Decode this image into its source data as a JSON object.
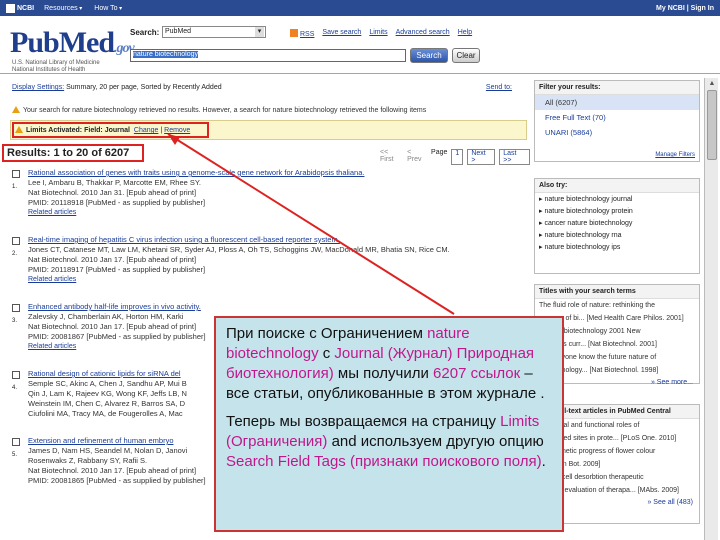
{
  "ncbi": {
    "logo": "NCBI",
    "resources": "Resources",
    "howto": "How To",
    "account": "My NCBI | Sign In"
  },
  "header": {
    "logo_main": "PubMed",
    "logo_gov": ".gov",
    "sub1": "U.S. National Library of Medicine",
    "sub2": "National Institutes of Health",
    "search_label": "Search:",
    "db_value": "PubMed",
    "links": [
      "RSS",
      "Save search",
      "Limits",
      "Advanced search",
      "Help"
    ],
    "query": "nature biotechnology",
    "search_btn": "Search",
    "clear_btn": "Clear"
  },
  "display": {
    "settings_label": "Display Settings:",
    "settings_value": "Summary, 20 per page, Sorted by Recently Added",
    "send_to": "Send to:"
  },
  "message": "Your search for nature biotechnology retrieved no results. However, a search for nature biotechnology retrieved the following items",
  "limits": {
    "label": "Limits Activated:",
    "value": "Field: Journal",
    "change": "Change",
    "remove": "Remove"
  },
  "results_count": "Results: 1 to 20 of 6207",
  "pager": {
    "first": "<< First",
    "prev": "< Prev",
    "page_label": "Page",
    "page": "1",
    "next": "Next >",
    "last": "Last >>"
  },
  "results": [
    {
      "num": "1.",
      "title": "Rational association of genes with traits using a genome-scale gene network for Arabidopsis thaliana.",
      "authors": "Lee I, Ambaru B, Thakkar P, Marcotte EM, Rhee SY.",
      "source": "Nat Biotechnol. 2010 Jan 31. [Epub ahead of print]",
      "pmid": "PMID: 20118918 [PubMed - as supplied by publisher]",
      "related": "Related articles"
    },
    {
      "num": "2.",
      "title": "Real-time imaging of hepatitis C virus infection using a fluorescent cell-based reporter system.",
      "authors": "Jones CT, Catanese MT, Law LM, Khetani SR, Syder AJ, Ploss A, Oh TS, Schoggins JW, MacDonald MR, Bhatia SN, Rice CM.",
      "source": "Nat Biotechnol. 2010 Jan 17. [Epub ahead of print]",
      "pmid": "PMID: 20118917 [PubMed - as supplied by publisher]",
      "related": "Related articles"
    },
    {
      "num": "3.",
      "title": "Enhanced antibody half-life improves in vivo activity.",
      "authors": "Zalevsky J, Chamberlain AK, Horton HM, Karki",
      "source": "Nat Biotechnol. 2010 Jan 17. [Epub ahead of print]",
      "pmid": "PMID: 20081867 [PubMed - as supplied by publisher]",
      "related": "Related articles"
    },
    {
      "num": "4.",
      "title": "Rational design of cationic lipids for siRNA del",
      "authors": "Semple SC, Akinc A, Chen J, Sandhu AP, Mui B",
      "source": "Qin J, Lam K, Rajeev KG, Wong KF, Jeffs LB, N",
      "pmid": "Weinstein IM, Chen C, Alvarez R, Barros SA, D",
      "related": "Ciufolini MA, Tracy MA, de Fougerolles A, Mac"
    },
    {
      "num": "5.",
      "title": "Extension and refinement of human embryo",
      "authors": "James D, Nam HS, Seandel M, Nolan D, Janovi",
      "source": "Rosenwaks Z, Rabbany SY, Rafii S.",
      "pmid": "Nat Biotechnol. 2010 Jan 17. [Epub ahead of print]",
      "related": "PMID: 20081865 [PubMed - as supplied by publisher]"
    }
  ],
  "filters": {
    "title": "Filter your results:",
    "items": [
      "All (6207)",
      "Free Full Text (70)",
      "UNARI (5864)"
    ],
    "manage": "Manage Filters"
  },
  "also_try": {
    "title": "Also try:",
    "items": [
      "nature biotechnology journal",
      "nature biotechnology protein",
      "cancer nature biotechnology",
      "nature biotechnology rna",
      "nature biotechnology ips"
    ]
  },
  "titles_box": {
    "title": "Titles with your search terms",
    "lines": [
      "The fluid role of nature: rethinking the",
      "process of bi... [Med Health Care Philos. 2001]",
      "[Nature biotechnology 2001 New",
      "solutions curr... [Nat Biotechnol. 2001]",
      "Can anyone know the future nature of",
      "biotechnology... [Nat Biotechnol. 1998]"
    ],
    "see_more": "» See more..."
  },
  "fulltext_box": {
    "title": "Free full-text articles in PubMed Central",
    "lines": [
      "Structural and functional roles of",
      "conserved sites in prote... [PLoS One. 2010]",
      "Ontogenetic progress of flower colour",
      "in... [Ann Bot. 2009]",
      "In vitro cell desorbtion therapeutic",
      "efficacy evaluation of therapa... [MAbs. 2009]"
    ],
    "see_all": "» See all (483)"
  },
  "callout": {
    "p1_a": "При поиске с Ограничением ",
    "p1_hl1": "nature biotechnology",
    "p1_b": " с ",
    "p1_hl2": "Journal (Журнал) Природная биотехнология)",
    "p1_c": "  мы получили  ",
    "p1_hl3": "6207 ссылок",
    "p1_d": " – все статьи, опубликованные в этом журнале .",
    "p2_a": "Теперь мы возвращаемся на страницу ",
    "p2_hl1": "Limits (Ограничения)",
    "p2_b": "  and используем другую опцию ",
    "p2_hl2": "Search Field Tags (признаки поискового поля)",
    "p2_c": "."
  },
  "colors": {
    "ncbi_bar": "#2a4a92",
    "link": "#1a3d9a",
    "highlight_red": "#d22",
    "callout_bg": "#c5e3eb",
    "callout_highlight": "#c0188c"
  }
}
